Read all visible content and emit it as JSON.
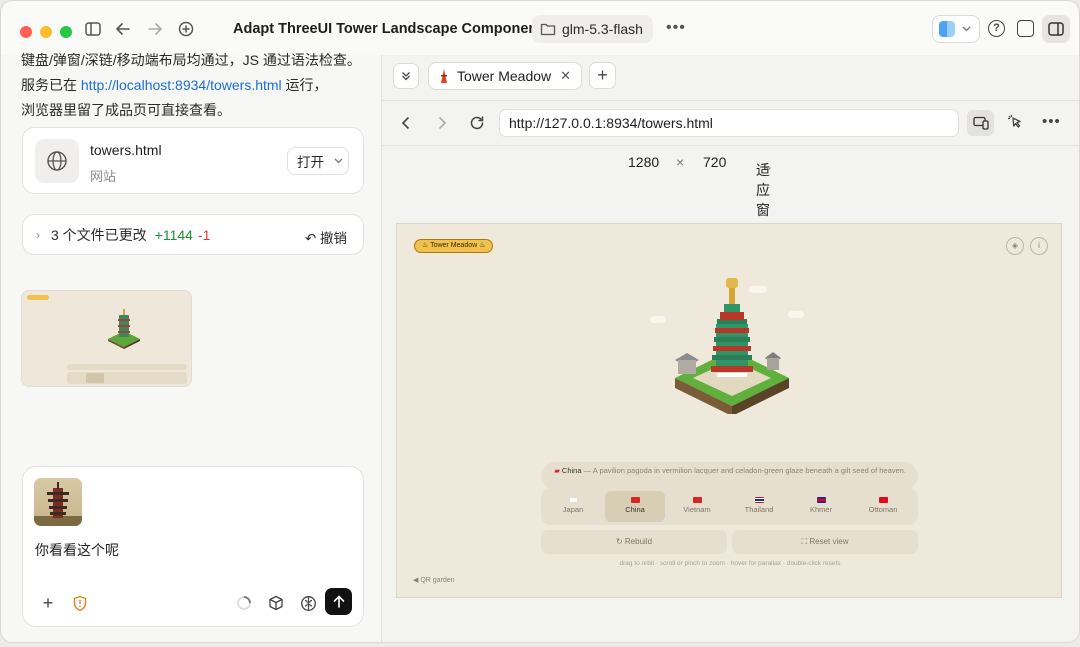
{
  "window": {
    "title": "Adapt ThreeUI Tower Landscape Component",
    "branch": "glm-5.3-flash"
  },
  "chat": {
    "message_line1": "键盘/弹窗/深链/移动端布局均通过，JS 通过语法检查。",
    "message_line2_prefix": "服务已在 ",
    "message_link": "http://localhost:8934/towers.html",
    "message_line2_suffix": " 运行，",
    "message_line3": "浏览器里留了成品页可直接查看。",
    "file_card": {
      "name": "towers.html",
      "type": "网站",
      "open_label": "打开"
    },
    "changes": {
      "label": "3 个文件已更改",
      "added": "+1144",
      "removed": "-1",
      "undo_label": "撤销"
    },
    "input": {
      "text": "你看看这个呢"
    }
  },
  "browser": {
    "tab_title": "Tower Meadow",
    "url": "http://127.0.0.1:8934/towers.html",
    "viewport_width": "1280",
    "times": "×",
    "viewport_height": "720",
    "fit_label": "适应窗口"
  },
  "page": {
    "badge": "Tower Meadow",
    "desc_country": "China",
    "desc_text": " — A pavilion pagoda in vermilion lacquer and celadon-green glaze beneath a gilt seed of heaven.",
    "chips": [
      {
        "label": "Japan",
        "flag": "#ffffff"
      },
      {
        "label": "China",
        "flag": "#d6261d"
      },
      {
        "label": "Vietnam",
        "flag": "#da251d"
      },
      {
        "label": "Thailand",
        "flag": "#2d2a6b"
      },
      {
        "label": "Khmer",
        "flag": "#032ea1"
      },
      {
        "label": "Ottoman",
        "flag": "#e30a17"
      }
    ],
    "rebuild_label": "Rebuild",
    "reset_label": "Reset view",
    "hint": "drag to orbit · scroll or pinch to zoom · hover for parallax · double-click resets",
    "qr_label": "QR garden"
  }
}
